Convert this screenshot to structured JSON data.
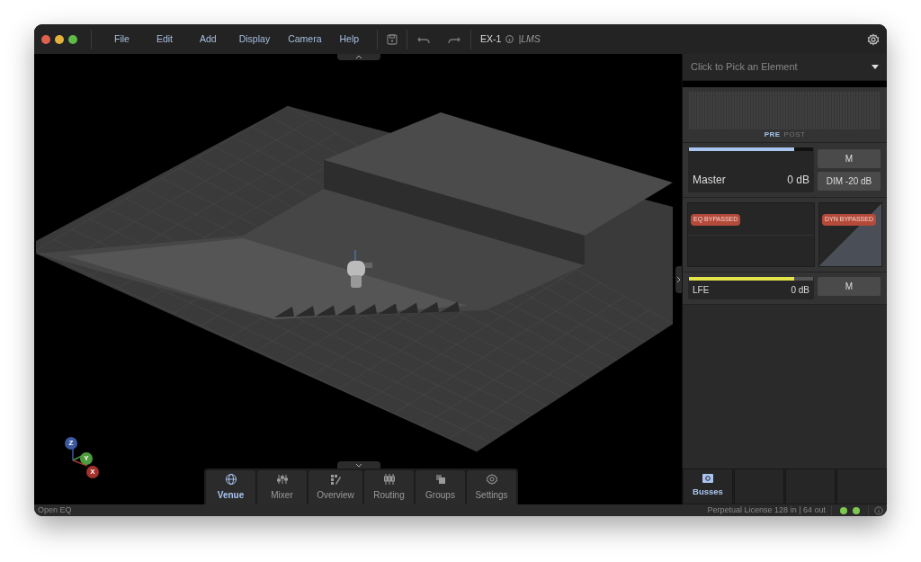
{
  "menu": [
    "File",
    "Edit",
    "Add",
    "Display",
    "Camera",
    "Help"
  ],
  "project": {
    "name": "EX-1",
    "suffix": "|LMS"
  },
  "axes": [
    {
      "label": "Z",
      "color": "#3b5aa0"
    },
    {
      "label": "Y",
      "color": "#4e9a3c"
    },
    {
      "label": "X",
      "color": "#a3322c"
    }
  ],
  "view_tabs": [
    {
      "label": "Venue",
      "selected": true
    },
    {
      "label": "Mixer",
      "selected": false
    },
    {
      "label": "Overview",
      "selected": false
    },
    {
      "label": "Routing",
      "selected": false
    },
    {
      "label": "Groups",
      "selected": false
    },
    {
      "label": "Settings",
      "selected": false
    }
  ],
  "panel": {
    "picker": {
      "placeholder": "Click to Pick an Element"
    },
    "meter_modes": [
      {
        "label": "PRE",
        "selected": true
      },
      {
        "label": "POST",
        "selected": false
      }
    ],
    "sections": [
      {
        "kind": "strip",
        "name": "Master",
        "reading": "0 dB",
        "level": 0.85,
        "color": "#a9c4ef",
        "buttons": [
          "M",
          "DIM -20 dB"
        ]
      },
      {
        "kind": "processing",
        "eq_badge": "EQ BYPASSED",
        "dyn_badge": "DYN BYPASSED"
      },
      {
        "kind": "compact",
        "name": "LFE",
        "reading": "0 dB",
        "level": 0.85,
        "color": "#e3e34a",
        "buttons": [
          "M"
        ]
      }
    ],
    "bottom_tabs": [
      {
        "label": "Busses",
        "selected": true
      }
    ]
  },
  "status_bar": {
    "left": "Open EQ",
    "license": "Perpetual License 128 in | 64 out",
    "indicators": [
      {
        "color": "#7ec850"
      },
      {
        "color": "#7ec850"
      }
    ]
  }
}
